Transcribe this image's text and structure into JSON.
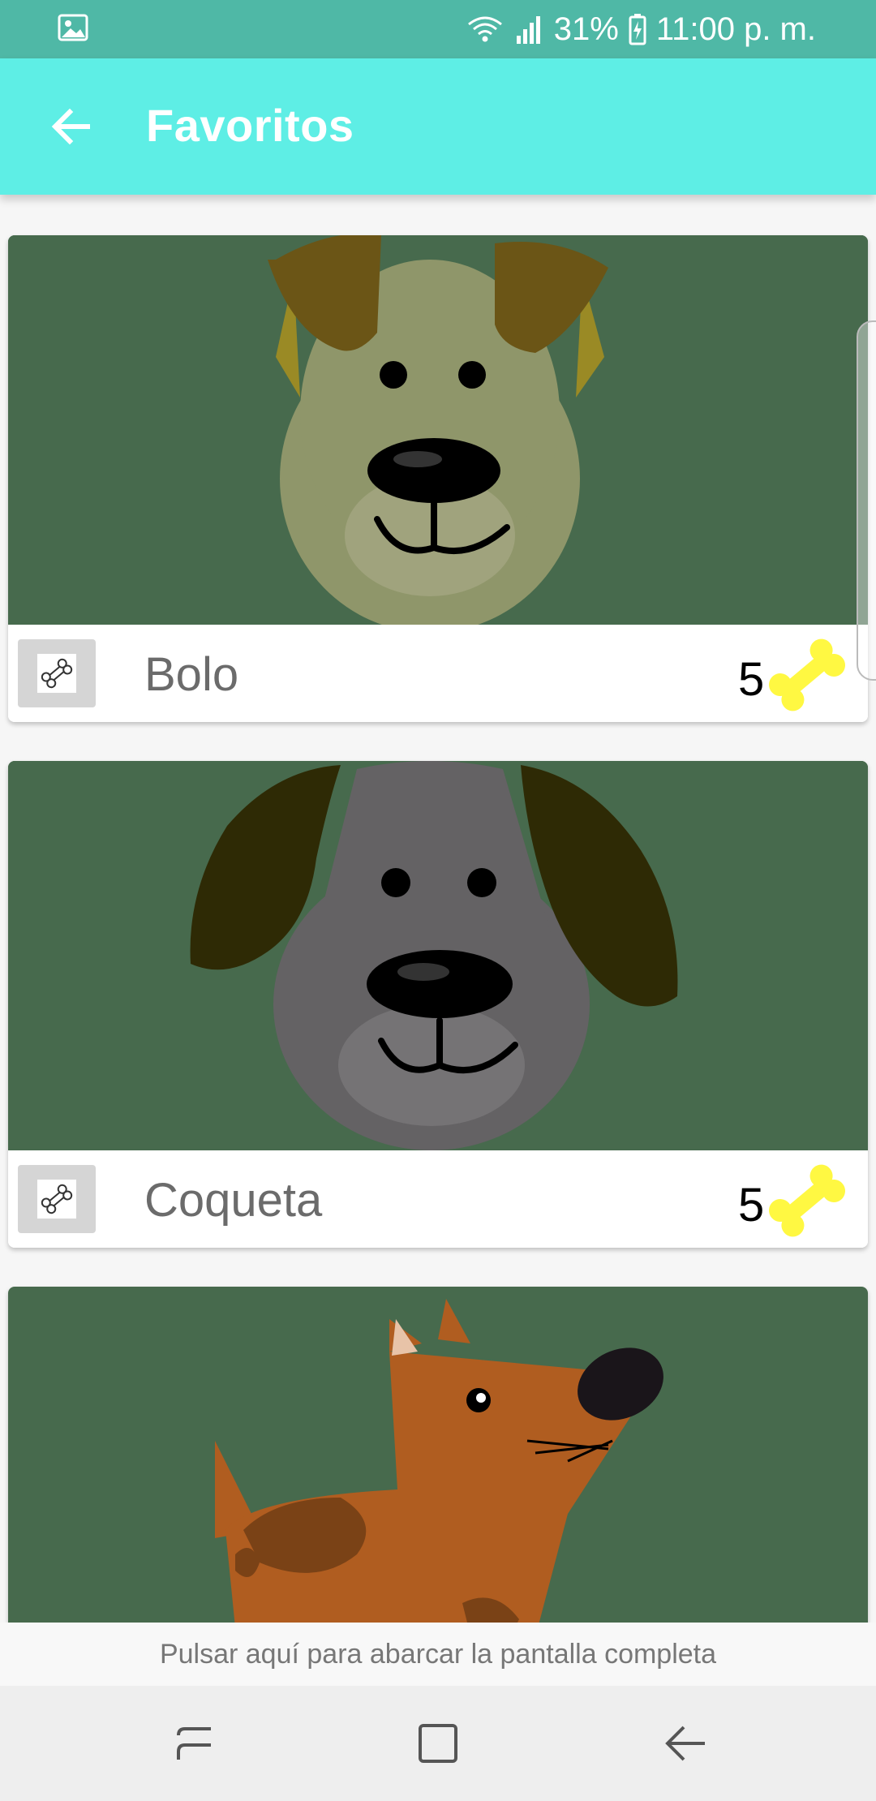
{
  "status_bar": {
    "battery": "31%",
    "time": "11:00 p. m.",
    "icons": [
      "gallery-icon",
      "wifi-icon",
      "signal-icon",
      "battery-charging-icon"
    ]
  },
  "app_bar": {
    "title": "Favoritos",
    "back_icon": "arrow-back-icon"
  },
  "pets": [
    {
      "name": "Bolo",
      "rating": "5",
      "like_icon": "bone-icon",
      "rating_icon": "bone-icon"
    },
    {
      "name": "Coqueta",
      "rating": "5",
      "like_icon": "bone-icon",
      "rating_icon": "bone-icon"
    },
    {
      "name": "",
      "rating": "",
      "like_icon": "bone-icon",
      "rating_icon": "bone-icon"
    }
  ],
  "fullscreen_hint": "Pulsar aquí para abarcar la pantalla completa",
  "nav_bar": {
    "icons": [
      "recent-apps-icon",
      "home-icon",
      "back-icon"
    ]
  },
  "colors": {
    "status_bar": "#4fb8a6",
    "app_bar": "#5eeee5",
    "card_photo_bg": "#476a4d",
    "bone_rating": "#fff842",
    "name_text": "#6b6b6b"
  }
}
